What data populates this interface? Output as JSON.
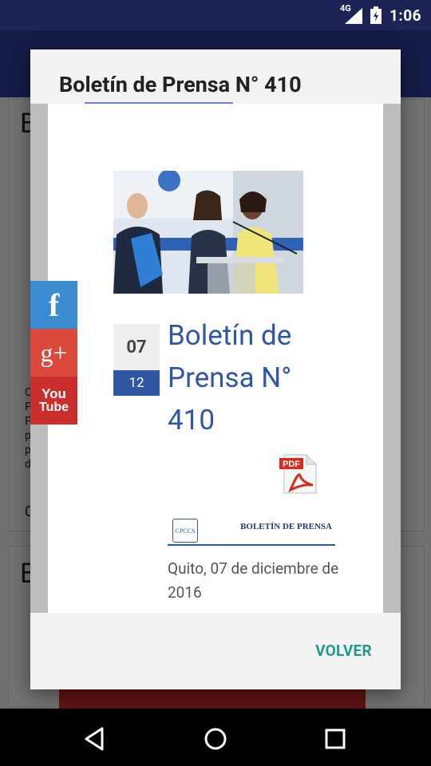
{
  "status_bar": {
    "network": "4G",
    "time": "1:06"
  },
  "background": {
    "card1_letter": "B",
    "card2_letter": "B",
    "snippet_lines": [
      "Qu",
      "PR",
      "PU",
      "pa",
      "po",
      "de"
    ],
    "count_digit": "0"
  },
  "dialog": {
    "title": "Boletín de Prensa N° 410",
    "date_day": "07",
    "date_month": "12",
    "article_title": "Boletín de Prensa N° 410",
    "pdf_icon": "pdf-icon",
    "bulletin_banner_title": "BOLETÍN DE PRENSA",
    "bulletin_banner_logo": "CPCCS",
    "place_date": "Quito, 07 de diciembre de 2016",
    "back_button": "VOLVER"
  },
  "social": {
    "facebook_label": "f",
    "googleplus_label": "g+",
    "youtube_label_top": "You",
    "youtube_label_bottom": "Tube"
  },
  "colors": {
    "title_blue": "#2f57a5",
    "volver_teal": "#1f9a8a",
    "facebook": "#3b8bd0",
    "googleplus": "#d9483b",
    "youtube": "#c9302c"
  }
}
